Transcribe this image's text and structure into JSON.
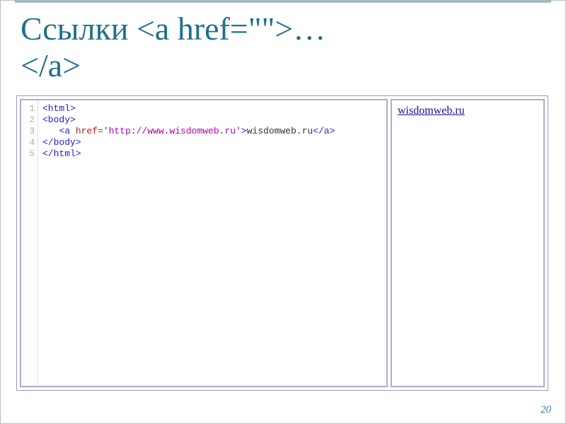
{
  "slide": {
    "title": "Ссылки <a href=\"\">…\n</a>",
    "page_number": "20"
  },
  "code": {
    "line_numbers": [
      "1",
      "2",
      "3",
      "4",
      "5"
    ],
    "lines": [
      {
        "indent": "",
        "segments": [
          {
            "cls": "tag",
            "t": "<html>"
          }
        ]
      },
      {
        "indent": "",
        "segments": [
          {
            "cls": "tag",
            "t": "<body>"
          }
        ]
      },
      {
        "indent": "   ",
        "segments": [
          {
            "cls": "tag",
            "t": "<a "
          },
          {
            "cls": "attr",
            "t": "href="
          },
          {
            "cls": "str",
            "t": "'http://www.wisdomweb.ru'"
          },
          {
            "cls": "tag",
            "t": ">"
          },
          {
            "cls": "txt",
            "t": "wisdomweb.ru"
          },
          {
            "cls": "tag",
            "t": "</a>"
          }
        ]
      },
      {
        "indent": "",
        "segments": [
          {
            "cls": "tag",
            "t": "</body>"
          }
        ]
      },
      {
        "indent": "",
        "segments": [
          {
            "cls": "tag",
            "t": "</html>"
          }
        ]
      }
    ]
  },
  "preview": {
    "link_text": "wisdomweb.ru"
  }
}
